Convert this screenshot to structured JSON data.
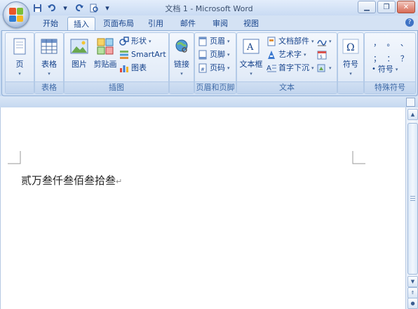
{
  "window": {
    "title": "文档 1 - Microsoft Word"
  },
  "quick_access": [
    "save-icon",
    "undo-icon",
    "redo-icon",
    "print-preview-icon",
    "customize-icon"
  ],
  "tabs": [
    {
      "label": "开始"
    },
    {
      "label": "插入"
    },
    {
      "label": "页面布局"
    },
    {
      "label": "引用"
    },
    {
      "label": "邮件"
    },
    {
      "label": "审阅"
    },
    {
      "label": "视图"
    }
  ],
  "ribbon": {
    "pages": {
      "label": "页",
      "group": ""
    },
    "tables": {
      "label": "表格",
      "group": "表格"
    },
    "illustrations": {
      "group": "插图",
      "picture": "图片",
      "clipart": "剪贴画",
      "shapes": "形状",
      "smartart": "SmartArt",
      "chart": "图表"
    },
    "links": {
      "label": "链接",
      "group": ""
    },
    "header_footer": {
      "group": "页眉和页脚",
      "header": "页眉",
      "footer": "页脚",
      "page_number": "页码"
    },
    "text": {
      "group": "文本",
      "textbox": "文本框",
      "quick_parts": "文档部件",
      "wordart": "艺术字",
      "dropcap": "首字下沉"
    },
    "symbols": {
      "label": "符号",
      "group": ""
    },
    "special": {
      "group": "特殊符号",
      "symbol": "符号",
      "chars": [
        "，",
        "。",
        "、",
        "；",
        "：",
        "？"
      ]
    }
  },
  "document": {
    "text": "贰万叁仟叁佰叁拾叁"
  },
  "colors": {
    "accent": "#15428b",
    "ribbon_bg": "#dbe7f6",
    "close": "#d76a55"
  }
}
